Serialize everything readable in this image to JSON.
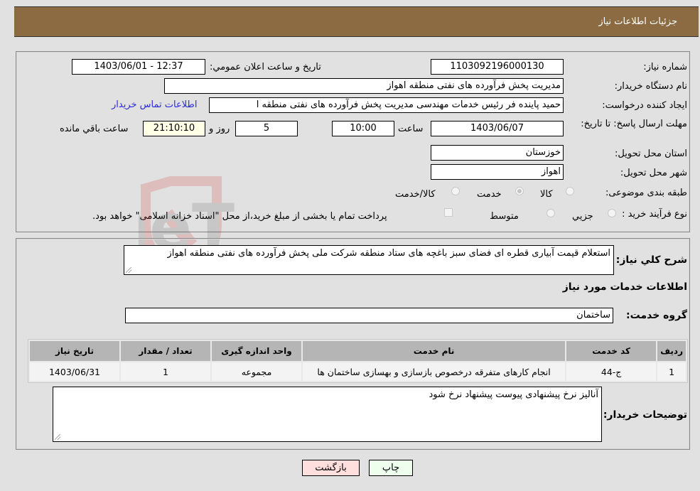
{
  "header": {
    "title": "جزئیات اطلاعات نیاز"
  },
  "form": {
    "need_number": {
      "label": "شماره نیاز:",
      "value": "1103092196000130"
    },
    "announce_datetime": {
      "label": "تاریخ و ساعت اعلان عمومي:",
      "value": "1403/06/01 - 12:37"
    },
    "buyer_org": {
      "label": "نام دستگاه خریدار:",
      "value": "مدیریت پخش فرآورده های نفتی منطقه اهواز"
    },
    "requester": {
      "label": "ایجاد کننده درخواست:",
      "value": "حمید پاینده فر رئیس خدمات مهندسی مدیریت پخش فرآورده های نفتی منطقه ا"
    },
    "buyer_contact_link": "اطلاعات تماس خریدار",
    "deadline": {
      "label": "مهلت ارسال پاسخ: تا تاریخ:",
      "date": "1403/06/07",
      "time_label": "ساعت",
      "time": "10:00",
      "days": "5",
      "days_label": "روز و",
      "remaining": "21:10:10",
      "remaining_label": "ساعت باقي مانده"
    },
    "province": {
      "label": "استان محل تحویل:",
      "value": "خوزستان"
    },
    "city": {
      "label": "شهر محل تحویل:",
      "value": "اهواز"
    },
    "category": {
      "label": "طبقه بندی موضوعی:",
      "options": [
        {
          "label": "کالا",
          "selected": false
        },
        {
          "label": "خدمت",
          "selected": true
        },
        {
          "label": "کالا/خدمت",
          "selected": false
        }
      ]
    },
    "purchase_type": {
      "label": "نوع فرآیند خرید :",
      "options": [
        {
          "label": "جزيي",
          "selected": false
        },
        {
          "label": "متوسط",
          "selected": false
        }
      ],
      "treasury_checkbox_label": "پرداخت تمام یا بخشی از مبلغ خرید،از محل \"اسناد خزانه اسلامی\" خواهد بود.",
      "treasury_checked": false
    }
  },
  "description": {
    "label": "شرح کلي نیاز:",
    "value": "استعلام قیمت آبیاری قطره ای فضای سبز باغچه های ستاد منطقه شرکت ملی پخش فرآورده های نفتی منطقه اهواز"
  },
  "services": {
    "section_title": "اطلاعات خدمات مورد نیاز",
    "group_label": "گروه خدمت:",
    "group_value": "ساختمان",
    "table": {
      "headers": [
        "ردیف",
        "کد خدمت",
        "نام خدمت",
        "واحد اندازه گیری",
        "تعداد / مقدار",
        "تاریخ نیاز"
      ],
      "rows": [
        [
          "1",
          "ج-44",
          "انجام کارهای متفرقه درخصوص بازسازی و بهسازی ساختمان ها",
          "مجموعه",
          "1",
          "1403/06/31"
        ]
      ]
    }
  },
  "buyer_notes": {
    "label": "توضیحات خریدار:",
    "value": "آنالیز نرخ پیشنهادی پیوست پیشنهاد نرخ شود"
  },
  "buttons": {
    "print": "چاپ",
    "back": "بازگشت"
  },
  "watermark": {
    "text": "AriaTender.neT"
  }
}
